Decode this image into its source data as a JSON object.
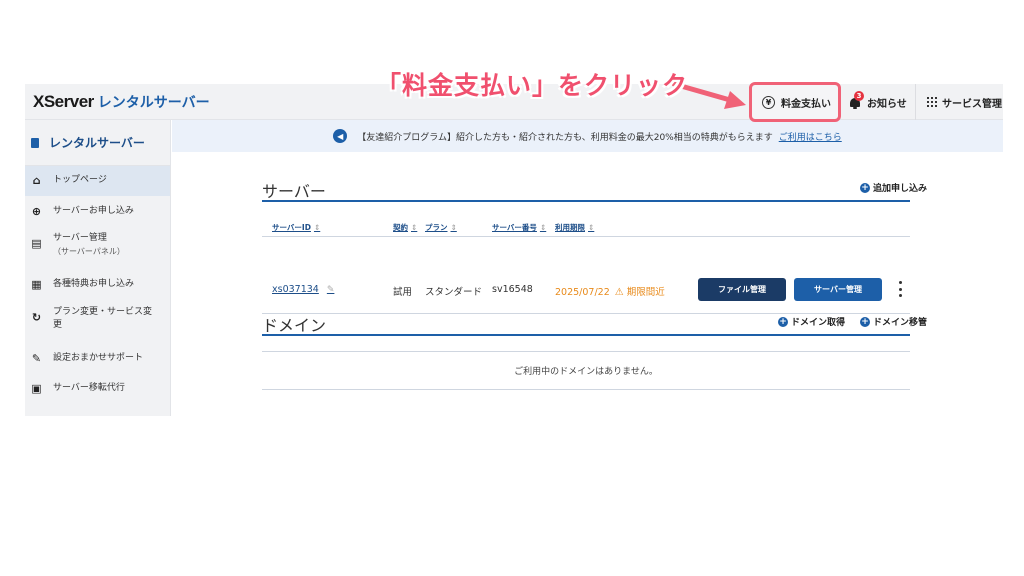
{
  "annotation": {
    "text": "「料金支払い」をクリック",
    "color": "#f0506e"
  },
  "header": {
    "logo": "XServer",
    "logo_sub": "レンタルサーバー",
    "pay_label": "料金支払い",
    "pay_icon": "yen-icon",
    "notice_label": "お知らせ",
    "notice_badge": "3",
    "services_label": "サービス管理"
  },
  "sidebar": {
    "title": "レンタルサーバー",
    "items": [
      {
        "label": "トップページ",
        "sub": "",
        "icon": "home-icon",
        "active": true
      },
      {
        "label": "サーバーお申し込み",
        "sub": "",
        "icon": "plus-circle-icon"
      },
      {
        "label": "サーバー管理",
        "sub": "（サーバーパネル）",
        "icon": "server-icon"
      },
      {
        "label": "各種特典お申し込み",
        "sub": "",
        "icon": "gift-icon"
      },
      {
        "label": "プラン変更・サービス変",
        "sub": "更",
        "icon": "refresh-icon"
      },
      {
        "label": "設定おまかせサポート",
        "sub": "",
        "icon": "wrench-icon"
      },
      {
        "label": "サーバー移転代行",
        "sub": "",
        "icon": "server-move-icon"
      }
    ]
  },
  "banner": {
    "text": "【友達紹介プログラム】紹介した方も・紹介された方も、利用料金の最大20%相当の特典がもらえます",
    "link": "ご利用はこちら"
  },
  "server_section": {
    "title": "サーバー",
    "add_label": "追加申し込み",
    "columns": [
      "サーバーID",
      "契約",
      "プラン",
      "サーバー番号",
      "利用期限"
    ],
    "row": {
      "id": "xs037134",
      "contract": "試用",
      "plan": "スタンダード",
      "server_no": "sv16548",
      "expiry": "2025/07/22",
      "expiry_warning": "期限間近"
    },
    "file_button": "ファイル管理",
    "server_button": "サーバー管理"
  },
  "domain_section": {
    "title": "ドメイン",
    "acquire_label": "ドメイン取得",
    "transfer_label": "ドメイン移管",
    "empty_text": "ご利用中のドメインはありません。"
  },
  "colors": {
    "accent": "#1d5fa8",
    "highlight": "#f06277",
    "warning": "#e88a1a"
  }
}
